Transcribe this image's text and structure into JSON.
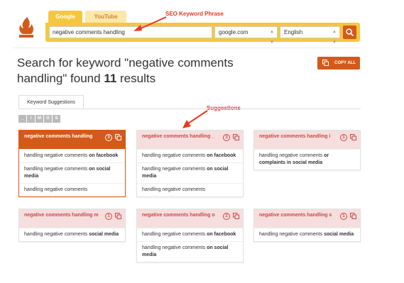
{
  "tabs": [
    {
      "label": "Google",
      "active": true
    },
    {
      "label": "YouTube",
      "active": false
    }
  ],
  "search": {
    "query": "negative comments handling",
    "domain": "google.com",
    "language": "English"
  },
  "annotations": {
    "seo": "SEO Keyword Phrase",
    "suggestions": "Suggestions"
  },
  "heading": {
    "prefix": "Search for keyword \"negative comments handling\" found ",
    "count": "11",
    "suffix": " results"
  },
  "copy_all_label": "COPY ALL",
  "keyword_tab_label": "Keyword Suggestions",
  "letters": [
    "_",
    "I",
    "M",
    "O",
    "S"
  ],
  "colors": {
    "accent": "#d35a1b",
    "tab_yellow": "#f4c73f",
    "annotation_red": "#e8381f",
    "card_header": "#f6dede"
  },
  "cards": [
    {
      "title": "negative comments handling",
      "count": "3",
      "active": true,
      "items": [
        {
          "text": "handling negative comments ",
          "bold": "on facebook"
        },
        {
          "text": "handling negative comments ",
          "bold": "on social media"
        },
        {
          "text": "handling negative comments",
          "bold": ""
        }
      ]
    },
    {
      "title": "negative comments handling _",
      "count": "3",
      "active": false,
      "items": [
        {
          "text": "handling negative comments ",
          "bold": "on facebook"
        },
        {
          "text": "handling negative comments ",
          "bold": "on social media"
        },
        {
          "text": "handling negative comments",
          "bold": ""
        }
      ]
    },
    {
      "title": "negative comments handling i",
      "count": "1",
      "active": false,
      "items": [
        {
          "text": "handling negative comments ",
          "bold": "or complaints in social media"
        }
      ]
    },
    {
      "title": "negative comments handling m",
      "count": "1",
      "active": false,
      "items": [
        {
          "text": "handling negative comments ",
          "bold": "social media"
        }
      ]
    },
    {
      "title": "negative comments handling o",
      "count": "2",
      "active": false,
      "items": [
        {
          "text": "handling negative comments ",
          "bold": "on facebook"
        },
        {
          "text": "handling negative comments ",
          "bold": "on social media"
        }
      ]
    },
    {
      "title": "negative comments handling s",
      "count": "1",
      "active": false,
      "items": [
        {
          "text": "handling negative comments ",
          "bold": "social media"
        }
      ]
    }
  ]
}
